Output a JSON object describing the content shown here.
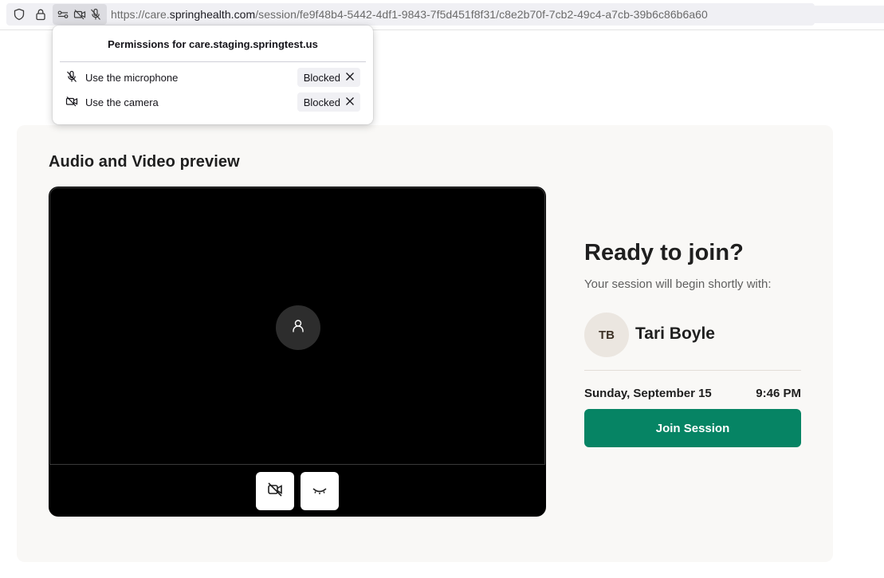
{
  "browser": {
    "url_prefix": "https://care.",
    "url_host": "springhealth.com",
    "url_path": "/session/fe9f48b4-5442-4df1-9843-7f5d451f8f31/c8e2b70f-7cb2-49c4-a7cb-39b6c86b6a60",
    "icons": [
      "shield-icon",
      "lock-icon",
      "permission-key-icon",
      "camera-blocked-icon",
      "microphone-blocked-icon"
    ]
  },
  "permissions_popup": {
    "title": "Permissions for care.staging.springtest.us",
    "items": [
      {
        "label": "Use the microphone",
        "status": "Blocked",
        "icon": "microphone-blocked-icon"
      },
      {
        "label": "Use the camera",
        "status": "Blocked",
        "icon": "camera-blocked-icon"
      }
    ]
  },
  "preview": {
    "title": "Audio and Video preview",
    "controls": [
      "video-off-icon",
      "eye-closed-icon"
    ]
  },
  "join_panel": {
    "title": "Ready to join?",
    "subtitle": "Your session will begin shortly with:",
    "provider_initials": "TB",
    "provider_name": "Tari Boyle",
    "date": "Sunday, September 15",
    "time": "9:46 PM",
    "join_label": "Join Session"
  },
  "colors": {
    "accent": "#068464",
    "card_bg": "#f9f8f6",
    "avatar_bg": "#ebe6e0"
  }
}
